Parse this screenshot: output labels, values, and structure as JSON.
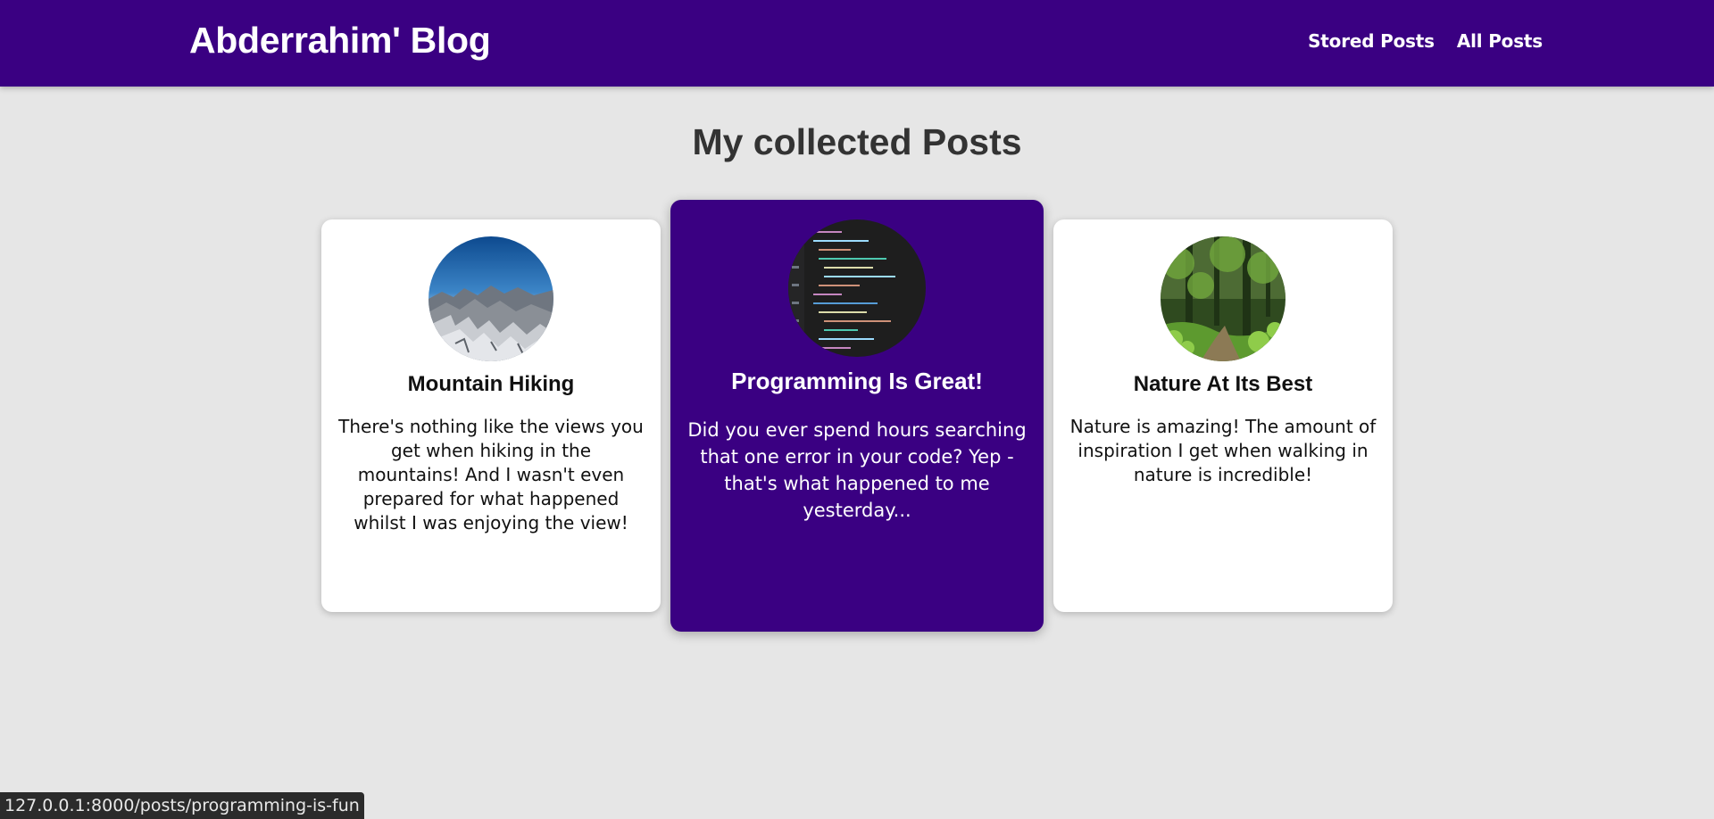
{
  "header": {
    "brand": "Abderrahim' Blog",
    "nav": [
      {
        "label": "Stored Posts"
      },
      {
        "label": "All Posts"
      }
    ]
  },
  "main": {
    "title": "My collected Posts",
    "posts": [
      {
        "title": "Mountain Hiking",
        "excerpt": "There's nothing like the views you get when hiking in the mountains! And I wasn't even prepared for what happened whilst I was enjoying the view!",
        "image_icon": "mountain-image"
      },
      {
        "title": "Programming Is Great!",
        "excerpt": "Did you ever spend hours searching that one error in your code? Yep - that's what happened to me yesterday...",
        "image_icon": "code-image",
        "hovered": true
      },
      {
        "title": "Nature At Its Best",
        "excerpt": "Nature is amazing! The amount of inspiration I get when walking in nature is incredible!",
        "image_icon": "forest-image"
      }
    ]
  },
  "status_bar": {
    "url": "127.0.0.1:8000/posts/programming-is-fun"
  },
  "colors": {
    "header_bg": "#3a0082",
    "page_bg": "#e6e6e6",
    "card_bg": "#ffffff",
    "active_card_bg": "#3a0082"
  }
}
